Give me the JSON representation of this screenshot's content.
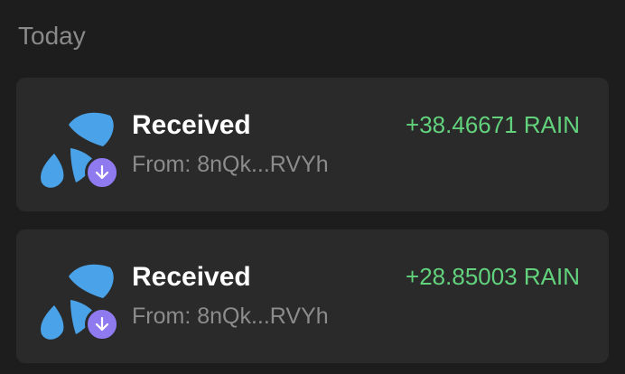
{
  "section": {
    "title": "Today"
  },
  "transactions": [
    {
      "type": "Received",
      "from": "From: 8nQk...RVYh",
      "amount": "+38.46671 RAIN",
      "token_icon": "rain-drops-icon",
      "badge_icon": "arrow-down-icon"
    },
    {
      "type": "Received",
      "from": "From: 8nQk...RVYh",
      "amount": "+28.85003 RAIN",
      "token_icon": "rain-drops-icon",
      "badge_icon": "arrow-down-icon"
    }
  ],
  "colors": {
    "background": "#1d1d1d",
    "card": "#2a2a2a",
    "amount_positive": "#62d27d",
    "badge": "#8f7af0",
    "token_blue": "#4aa3e8",
    "secondary_text": "#8c8c8c"
  }
}
